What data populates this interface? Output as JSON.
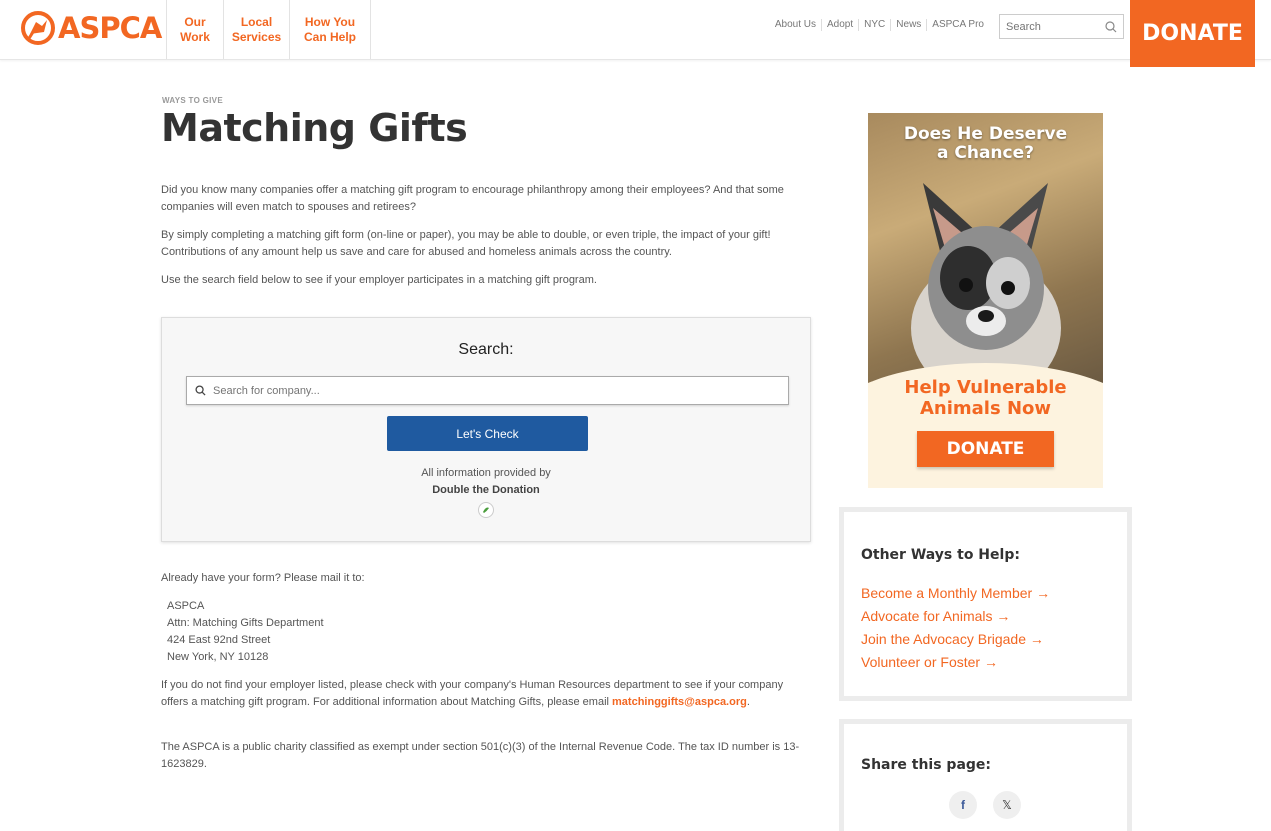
{
  "brand": {
    "logo_text": "ASPCA",
    "accent": "#f26722",
    "button_blue": "#1f5aa0"
  },
  "header": {
    "main_nav": [
      {
        "label_line1": "Our",
        "label_line2": "Work"
      },
      {
        "label_line1": "Local",
        "label_line2": "Services"
      },
      {
        "label_line1": "How You",
        "label_line2": "Can Help"
      }
    ],
    "util_nav": [
      "About Us",
      "Adopt",
      "NYC",
      "News",
      "ASPCA Pro"
    ],
    "search_placeholder": "Search",
    "donate_label": "DONATE"
  },
  "main": {
    "eyebrow": "WAYS TO GIVE",
    "title": "Matching Gifts",
    "para1": "Did you know many companies offer a matching gift program to encourage philanthropy among their employees?  And that some companies will even match to spouses and retirees?",
    "para2": "By simply completing a matching gift form (on-line or paper), you may be able to double, or even triple, the impact of your gift!  Contributions of any amount help us save and care for abused and homeless animals across the country.",
    "para3": "Use the search field below to see if your employer participates in a matching gift program.",
    "search_card": {
      "label": "Search:",
      "placeholder": "Search for company...",
      "button_label": "Let's Check",
      "provided_by": "All information provided by",
      "provider": "Double the Donation"
    },
    "para4": "Already have your form? Please mail it to:",
    "address": [
      "ASPCA",
      "Attn: Matching Gifts Department",
      "424 East 92nd Street",
      "New York, NY 10128"
    ],
    "para5_text": "If you do not find your employer listed, please check with your company's Human Resources department to see if your company offers a matching gift program. For additional information about Matching Gifts, please email ",
    "para5_email": "matchinggifts@aspca.org",
    "para5_end": ".",
    "para6": "The ASPCA is a public charity classified as exempt under section 501(c)(3) of the Internal Revenue Code.  The tax ID number is 13-1623829."
  },
  "sidebar": {
    "ad": {
      "headline_line1": "Does He Deserve",
      "headline_line2": "a Chance?",
      "sub_line1": "Help Vulnerable",
      "sub_line2": "Animals Now",
      "button_label": "DONATE"
    },
    "other_ways": {
      "heading": "Other Ways to Help:",
      "links": [
        "Become a Monthly Member →",
        "Advocate for Animals →",
        "Join the Advocacy Brigade →",
        "Volunteer or Foster →"
      ]
    },
    "share": {
      "heading": "Share this page:",
      "icons": [
        "facebook-icon",
        "x-icon"
      ]
    }
  }
}
